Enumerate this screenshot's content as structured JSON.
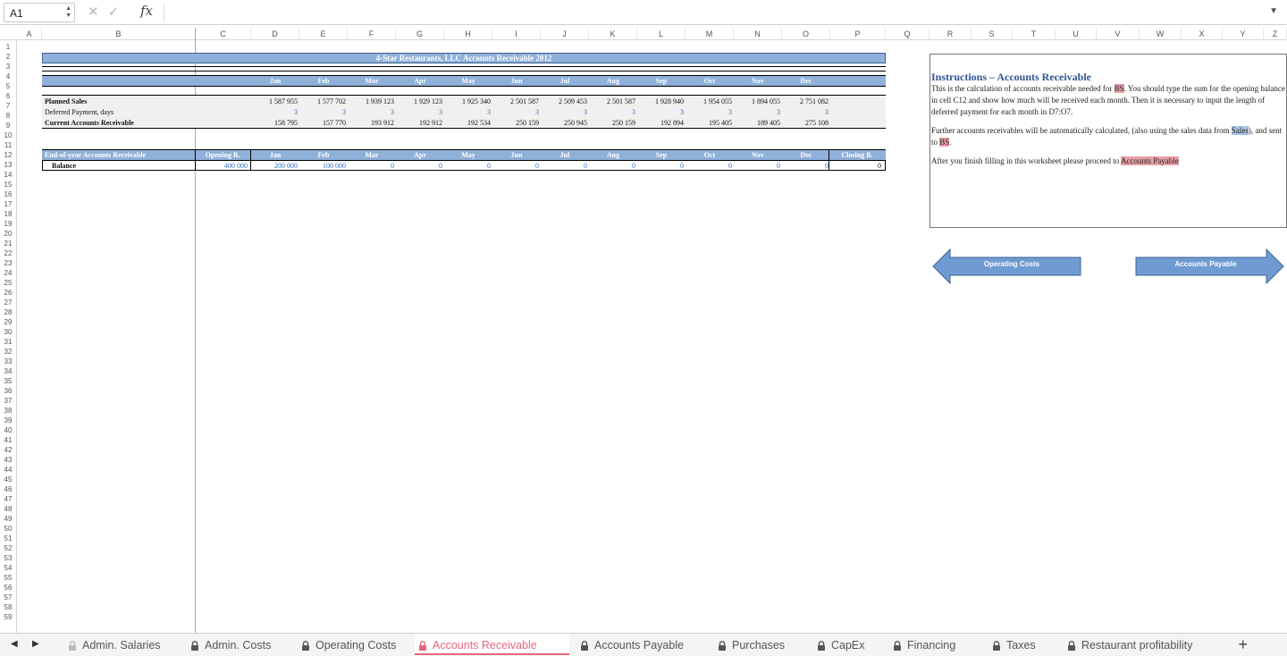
{
  "formula_bar": {
    "cell_ref": "A1",
    "cancel": "✕",
    "confirm": "✓",
    "fx": "fx"
  },
  "columns": [
    "A",
    "B",
    "C",
    "D",
    "E",
    "F",
    "G",
    "H",
    "I",
    "J",
    "K",
    "L",
    "M",
    "N",
    "O",
    "P",
    "Q",
    "R",
    "S",
    "T",
    "U",
    "V",
    "W",
    "X",
    "Y",
    "Z"
  ],
  "row_count": 59,
  "title": "4-Star Restaurants, LLC Accounts Receivable 2012",
  "months": [
    "Jan",
    "Feb",
    "Mar",
    "Apr",
    "May",
    "Jun",
    "Jul",
    "Aug",
    "Sep",
    "Oct",
    "Nov",
    "Dec"
  ],
  "rows": {
    "planned_sales": {
      "label": "Planned Sales",
      "values": [
        "1 587 955",
        "1 577 702",
        "1 939 123",
        "1 929 123",
        "1 925 340",
        "2 501 587",
        "2 509 453",
        "2 501 587",
        "1 928 940",
        "1 954 055",
        "1 894 055",
        "2 751 082"
      ]
    },
    "deferred": {
      "label": "Deferred Payment, days",
      "values": [
        "3",
        "3",
        "3",
        "3",
        "3",
        "3",
        "3",
        "3",
        "3",
        "3",
        "3",
        "3"
      ]
    },
    "current_ar": {
      "label": "Current Accounts Receivable",
      "values": [
        "158 795",
        "157 770",
        "193 912",
        "192 912",
        "192 534",
        "250 159",
        "250 945",
        "250 159",
        "192 894",
        "195 405",
        "189 405",
        "275 108"
      ]
    }
  },
  "balance_table": {
    "header_label": "End-of-year Accounts Receivable",
    "opening_label": "Opening B.",
    "closing_label": "Closing B.",
    "row_label": "Balance",
    "opening_value": "400 000",
    "values": [
      "200 000",
      "100 000",
      "0",
      "0",
      "0",
      "0",
      "0",
      "0",
      "0",
      "0",
      "0",
      "0"
    ],
    "closing_value": "0"
  },
  "instructions": {
    "title": "Instructions – Accounts Receivable",
    "p1_a": "This is the calculation of accounts receivable needed for ",
    "p1_bs": "BS",
    "p1_b": ". You should type the sum for the opening balance in cell C12 and show how much will be received each month. Then it is necessary to input the length of deferred payment for each month in D7:O7.",
    "p2_a": "Further accounts receivables will be automatically calculated, (also using the sales data from ",
    "p2_sales": "Sales",
    "p2_b": "), and sent to ",
    "p2_bs": "BS",
    "p2_c": ".",
    "p3_a": "After you finish filling in this worksheet please proceed to ",
    "p3_link": "Accounts Payable"
  },
  "nav_buttons": {
    "back": "Operating Costs",
    "forward": "Accounts Payable"
  },
  "tabs": [
    "Admin. Salaries",
    "Admin. Costs",
    "Operating Costs",
    "Accounts Receivable",
    "Accounts Payable",
    "Purchases",
    "CapEx",
    "Financing",
    "Taxes",
    "Restaurant profitability"
  ],
  "active_tab": "Accounts Receivable",
  "add_sheet": "+",
  "colors": {
    "header_blue": "#8fb0d9",
    "value_blue": "#2e6fc4",
    "active_tab": "#e2687a",
    "highlight_red": "#e8a0a6",
    "arrow_fill": "#6f9bd2"
  }
}
